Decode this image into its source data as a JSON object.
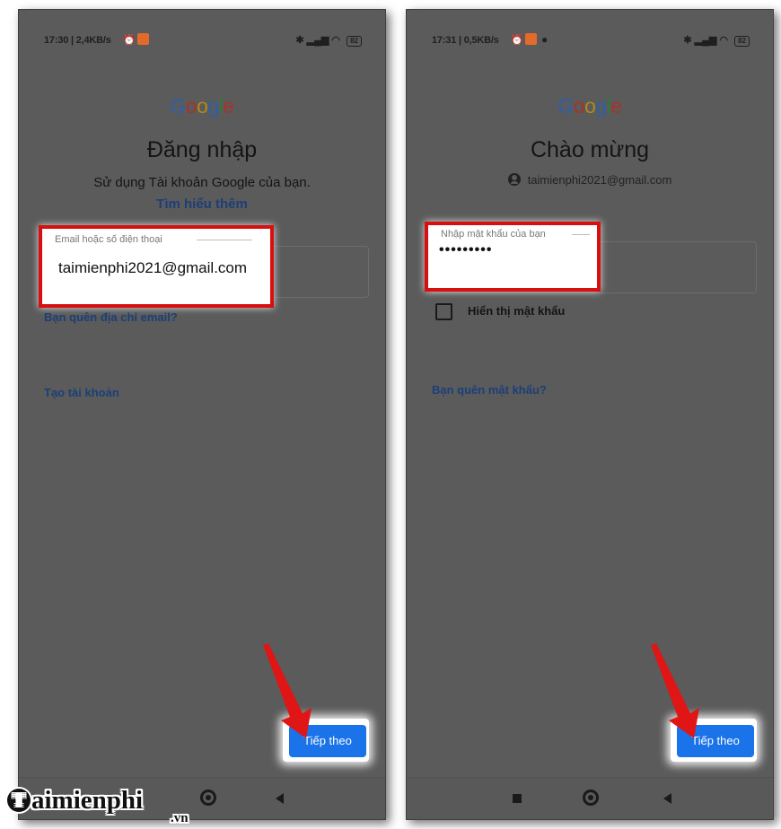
{
  "left_screen": {
    "status": {
      "time": "17:30 | 2,4KB/s"
    },
    "logo": "Google",
    "heading": "Đăng nhập",
    "subtitle": "Sử dụng Tài khoản Google của bạn.",
    "learn_more": "Tìm hiểu thêm",
    "email_field": {
      "label": "Email hoặc số điện thoại",
      "value": "taimienphi2021@gmail.com"
    },
    "forgot_email": "Bạn quên địa chỉ email?",
    "create_account": "Tạo tài khoản",
    "next_button": "Tiếp theo"
  },
  "right_screen": {
    "status": {
      "time": "17:31 | 0,5KB/s"
    },
    "logo": "Google",
    "heading": "Chào mừng",
    "account_email": "taimienphi2021@gmail.com",
    "password_field": {
      "label": "Nhập mật khẩu của bạn",
      "value": "•••••••••"
    },
    "show_password": "Hiển thị mật khẩu",
    "forgot_password": "Bạn quên mật khẩu?",
    "next_button": "Tiếp theo"
  },
  "status_bar": {
    "battery": "82"
  },
  "watermark": {
    "brand": "aimienphi",
    "logo_letter": "T",
    "tld": ".vn"
  },
  "colors": {
    "screen_bg": "#5b5b5b",
    "highlight": "#d90f0f",
    "button": "#1a73e8",
    "link": "#1c3f78"
  },
  "icons": [
    "account-circle-icon",
    "checkbox-icon",
    "red-arrow-icon",
    "recents-square-icon",
    "home-circle-icon",
    "back-triangle-icon",
    "bluetooth-icon",
    "signal-icon",
    "wifi-icon",
    "battery-icon",
    "alarm-icon"
  ]
}
